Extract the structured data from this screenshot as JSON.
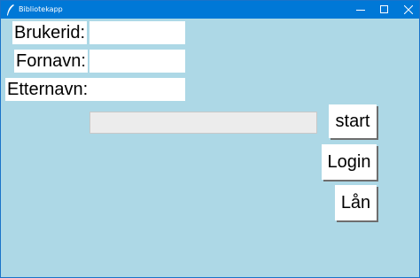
{
  "window": {
    "title": "Bibliotekapp",
    "controls": {
      "minimize": "minimize-icon",
      "maximize": "maximize-icon",
      "close": "close-icon"
    }
  },
  "colors": {
    "titlebar": "#0078d7",
    "background": "#add8e6",
    "progress_track": "#ececec"
  },
  "form": {
    "brukerid_label": "Brukerid:",
    "fornavn_label": "Fornavn:",
    "etternavn_label": "Etternavn:",
    "brukerid_value": "",
    "fornavn_value": "",
    "etternavn_value": ""
  },
  "progress": {
    "value": 0
  },
  "buttons": {
    "start": "start",
    "login": "Login",
    "lan": "Lån"
  }
}
